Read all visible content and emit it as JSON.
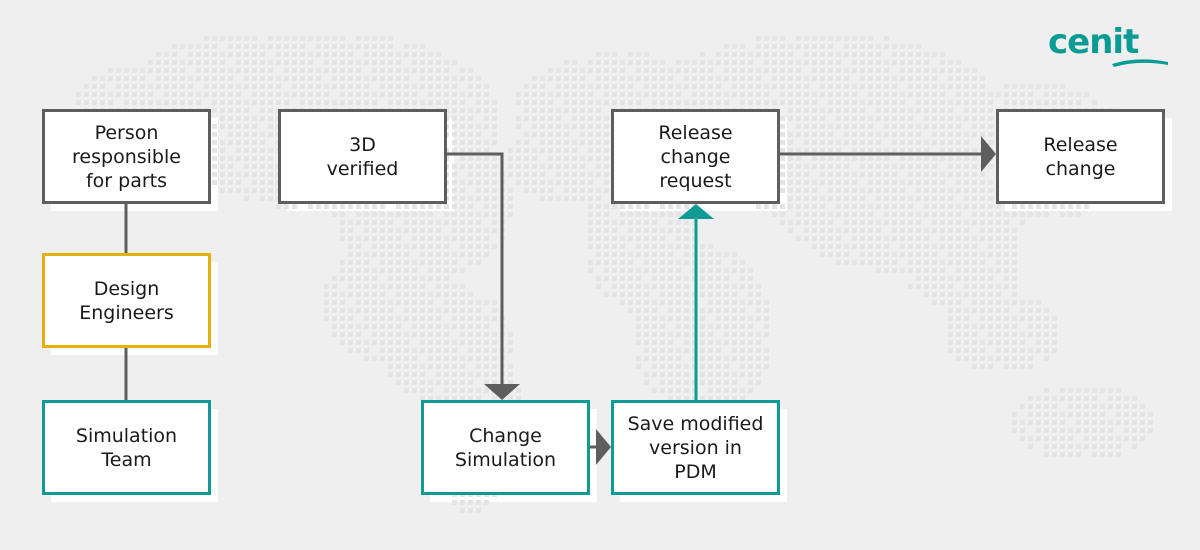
{
  "logo": {
    "text": "cenit",
    "color": "#0a9b94"
  },
  "colors": {
    "background": "#efefef",
    "gray_border": "#5e5e5e",
    "yellow_border": "#e6b010",
    "teal_border": "#0e9a95",
    "connector_gray": "#5e5e5e",
    "connector_teal": "#0e9a95"
  },
  "nodes": {
    "person_responsible": {
      "label": "Person\nresponsible\nfor parts",
      "style": "gray"
    },
    "design_engineers": {
      "label": "Design\nEngineers",
      "style": "yellow"
    },
    "simulation_team": {
      "label": "Simulation\nTeam",
      "style": "teal"
    },
    "verified_3d": {
      "label": "3D\nverified",
      "style": "gray"
    },
    "change_simulation": {
      "label": "Change\nSimulation",
      "style": "teal"
    },
    "save_modified": {
      "label": "Save modified\nversion in\nPDM",
      "style": "teal"
    },
    "release_change_request": {
      "label": "Release\nchange\nrequest",
      "style": "gray"
    },
    "release_change": {
      "label": "Release\nchange",
      "style": "gray"
    }
  },
  "edges": [
    {
      "from": "person_responsible",
      "to": "design_engineers",
      "type": "line",
      "color": "gray"
    },
    {
      "from": "design_engineers",
      "to": "simulation_team",
      "type": "line",
      "color": "gray"
    },
    {
      "from": "verified_3d",
      "to": "change_simulation",
      "type": "arrow",
      "color": "gray"
    },
    {
      "from": "change_simulation",
      "to": "save_modified",
      "type": "arrow",
      "color": "gray"
    },
    {
      "from": "save_modified",
      "to": "release_change_request",
      "type": "arrow",
      "color": "teal"
    },
    {
      "from": "release_change_request",
      "to": "release_change",
      "type": "arrow",
      "color": "gray"
    }
  ]
}
